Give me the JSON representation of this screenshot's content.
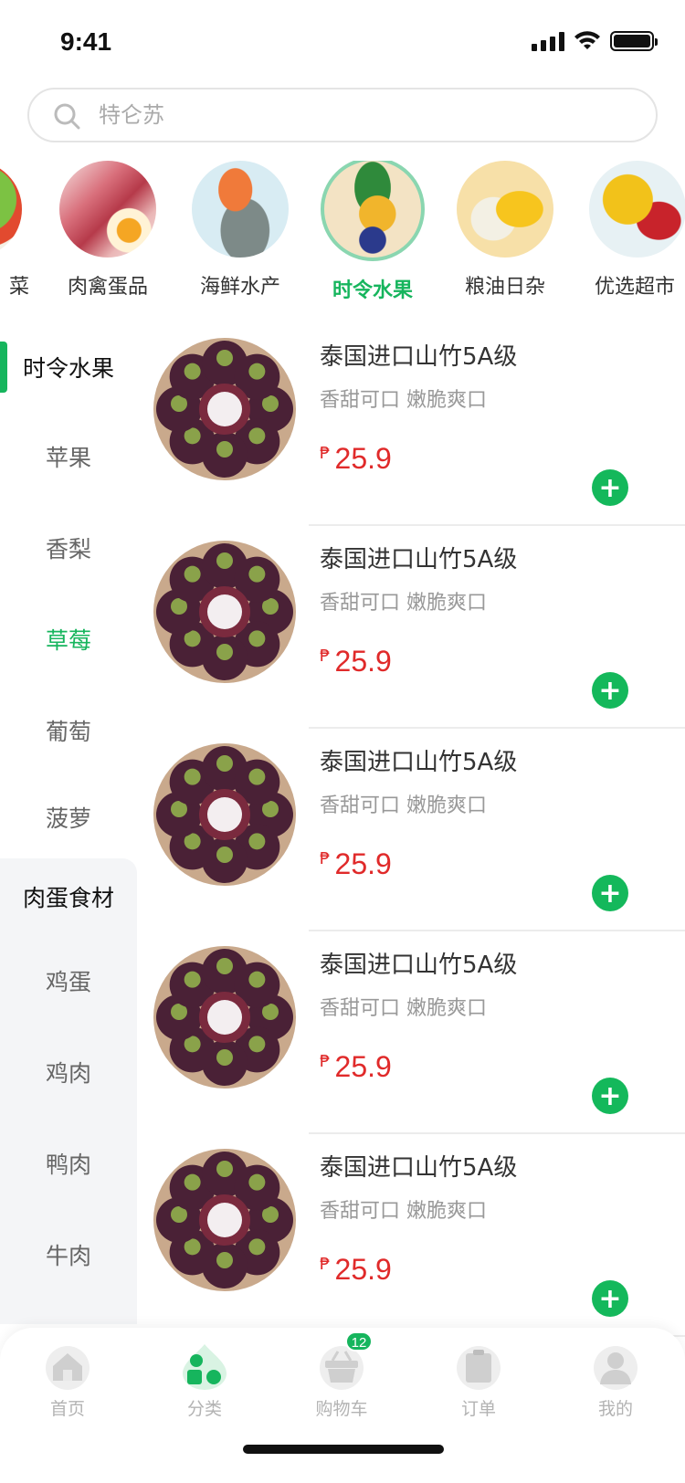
{
  "status_bar": {
    "time": "9:41"
  },
  "search": {
    "placeholder": "特仑苏"
  },
  "categories": [
    {
      "label": "菜",
      "icon": "vegetable-image"
    },
    {
      "label": "肉禽蛋品",
      "icon": "meat-egg-image"
    },
    {
      "label": "海鲜水产",
      "icon": "seafood-image"
    },
    {
      "label": "时令水果",
      "icon": "fruit-image",
      "active": true
    },
    {
      "label": "粮油日杂",
      "icon": "grain-oil-image"
    },
    {
      "label": "优选超市",
      "icon": "snack-image"
    }
  ],
  "sidebar": {
    "group1": {
      "title": "时令水果",
      "items": [
        "苹果",
        "香梨",
        "草莓",
        "葡萄",
        "菠萝"
      ],
      "active_item": "草莓"
    },
    "group2": {
      "title": "肉蛋食材",
      "items": [
        "鸡蛋",
        "鸡肉",
        "鸭肉",
        "牛肉"
      ]
    }
  },
  "products": [
    {
      "title": "泰国进口山竹5A级",
      "desc": "香甜可口 嫩脆爽口",
      "currency": "₱",
      "price": "25.9"
    },
    {
      "title": "泰国进口山竹5A级",
      "desc": "香甜可口 嫩脆爽口",
      "currency": "₱",
      "price": "25.9"
    },
    {
      "title": "泰国进口山竹5A级",
      "desc": "香甜可口 嫩脆爽口",
      "currency": "₱",
      "price": "25.9"
    },
    {
      "title": "泰国进口山竹5A级",
      "desc": "香甜可口 嫩脆爽口",
      "currency": "₱",
      "price": "25.9"
    },
    {
      "title": "泰国进口山竹5A级",
      "desc": "香甜可口 嫩脆爽口",
      "currency": "₱",
      "price": "25.9"
    }
  ],
  "add_button": {
    "symbol": "+"
  },
  "tab_bar": {
    "tabs": [
      {
        "label": "首页",
        "icon": "home-icon"
      },
      {
        "label": "分类",
        "icon": "category-icon",
        "active": true
      },
      {
        "label": "购物车",
        "icon": "cart-icon",
        "badge": "12"
      },
      {
        "label": "订单",
        "icon": "order-icon"
      },
      {
        "label": "我的",
        "icon": "profile-icon"
      }
    ]
  },
  "colors": {
    "accent": "#16b55d",
    "price": "#e02a2a"
  }
}
